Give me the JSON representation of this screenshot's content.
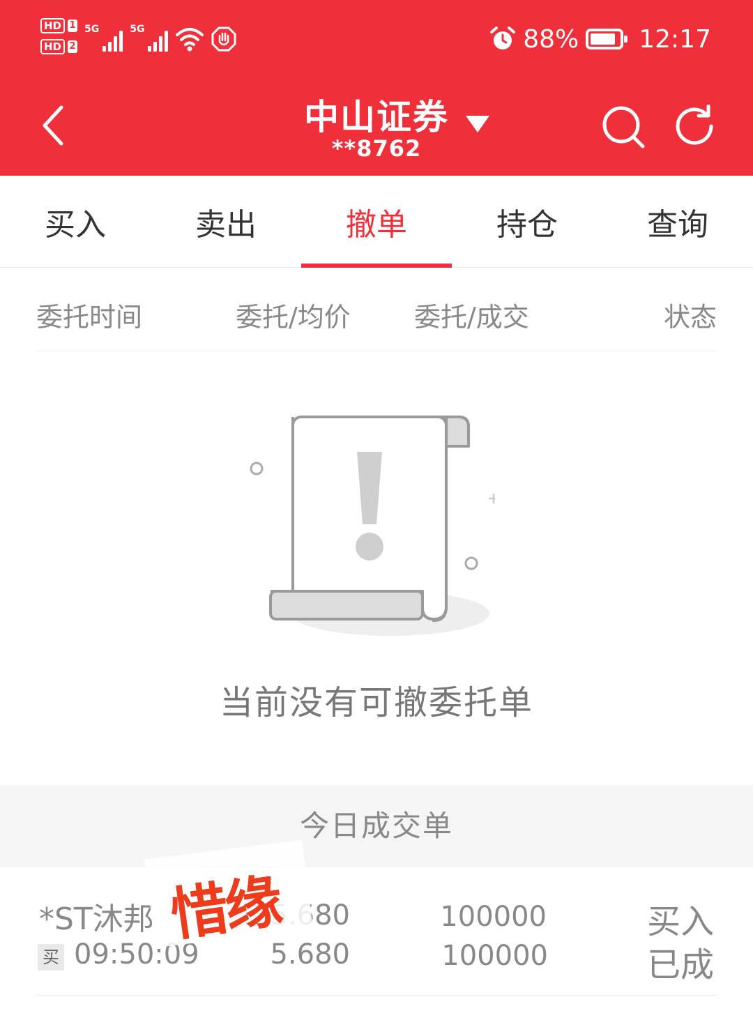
{
  "status_bar": {
    "hd1_label": "HD",
    "hd1_num": "1",
    "hd2_label": "HD",
    "hd2_num": "2",
    "sim1_network": "5G",
    "sim2_network": "5G",
    "battery_percent": "88%",
    "battery_level": 0.88,
    "time": "12:17"
  },
  "nav": {
    "title": "中山证券",
    "account": "**8762"
  },
  "tabs": [
    {
      "label": "买入",
      "active": false
    },
    {
      "label": "卖出",
      "active": false
    },
    {
      "label": "撤单",
      "active": true
    },
    {
      "label": "持仓",
      "active": false
    },
    {
      "label": "查询",
      "active": false
    }
  ],
  "columns": {
    "time": "委托时间",
    "price": "委托/均价",
    "volume": "委托/成交",
    "status": "状态"
  },
  "empty_state": {
    "message": "当前没有可撤委托单"
  },
  "today": {
    "section_title": "今日成交单",
    "trades": [
      {
        "name": "*ST沐邦",
        "side_tag": "买",
        "time": "09:50:09",
        "order_price": "5.680",
        "avg_price": "5.680",
        "order_qty": "100000",
        "filled_qty": "100000",
        "direction": "买入",
        "status": "已成"
      }
    ]
  },
  "watermark": {
    "text": "惜缘"
  },
  "colors": {
    "brand_red": "#ef2f3a",
    "watermark_red": "#ee3b1c"
  }
}
